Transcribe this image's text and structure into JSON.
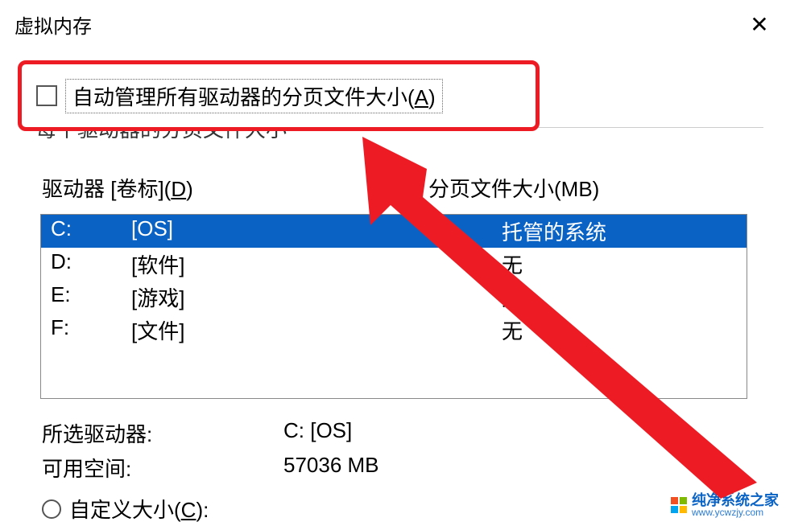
{
  "window": {
    "title": "虚拟内存"
  },
  "auto_manage": {
    "label_pre": "自动管理所有驱动器的分页文件大小(",
    "hotkey": "A",
    "label_post": ")"
  },
  "group_title": "每个驱动器的分页文件大小",
  "headers": {
    "drive_pre": "驱动器  [卷标](",
    "drive_hotkey": "D",
    "drive_post": ")",
    "paging": "分页文件大小(MB)"
  },
  "drives": [
    {
      "letter": "C:",
      "label": "[OS]",
      "size": "托管的系统",
      "selected": true
    },
    {
      "letter": "D:",
      "label": "[软件]",
      "size": "无",
      "selected": false
    },
    {
      "letter": "E:",
      "label": "[游戏]",
      "size": "无",
      "selected": false
    },
    {
      "letter": "F:",
      "label": "[文件]",
      "size": "无",
      "selected": false
    }
  ],
  "selected_info": {
    "drive_label": "所选驱动器:",
    "drive_value": "C:  [OS]",
    "space_label": "可用空间:",
    "space_value": "57036 MB"
  },
  "custom_size": {
    "label_pre": "自定义大小(",
    "hotkey": "C",
    "label_post": "):"
  },
  "watermark": {
    "name": "纯净系统之家",
    "url": "www.ycwzjy.com"
  }
}
